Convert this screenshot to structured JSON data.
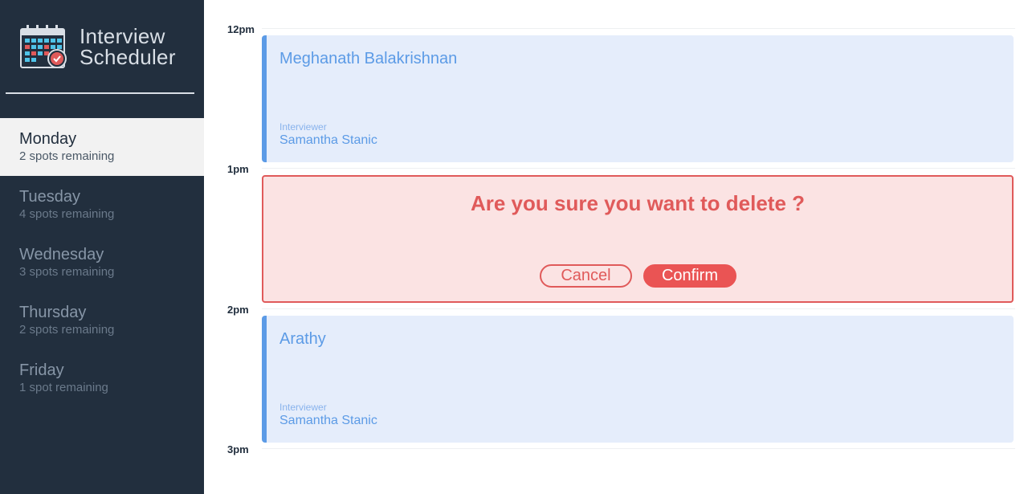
{
  "app": {
    "title_line1": "Interview",
    "title_line2": "Scheduler",
    "logo_icon": "calendar-check-icon"
  },
  "sidebar": {
    "days": [
      {
        "name": "Monday",
        "spots": "2 spots remaining",
        "selected": true
      },
      {
        "name": "Tuesday",
        "spots": "4 spots remaining",
        "selected": false
      },
      {
        "name": "Wednesday",
        "spots": "3 spots remaining",
        "selected": false
      },
      {
        "name": "Thursday",
        "spots": "2 spots remaining",
        "selected": false
      },
      {
        "name": "Friday",
        "spots": "1 spot remaining",
        "selected": false
      }
    ]
  },
  "schedule": {
    "hours": [
      "12pm",
      "1pm",
      "2pm",
      "3pm"
    ],
    "appointments": [
      {
        "student": "Meghanath Balakrishnan",
        "interviewer_label": "Interviewer",
        "interviewer": "Samantha Stanic"
      },
      {
        "student": "Arathy",
        "interviewer_label": "Interviewer",
        "interviewer": "Samantha Stanic"
      }
    ],
    "confirm": {
      "message": "Are you sure you want to delete ?",
      "cancel_label": "Cancel",
      "confirm_label": "Confirm"
    }
  },
  "colors": {
    "sidebar_bg": "#222f3e",
    "appointment_bg": "#e5edfb",
    "appointment_accent": "#5c9be6",
    "danger": "#e05a5a",
    "danger_bg": "#fbe3e3"
  }
}
